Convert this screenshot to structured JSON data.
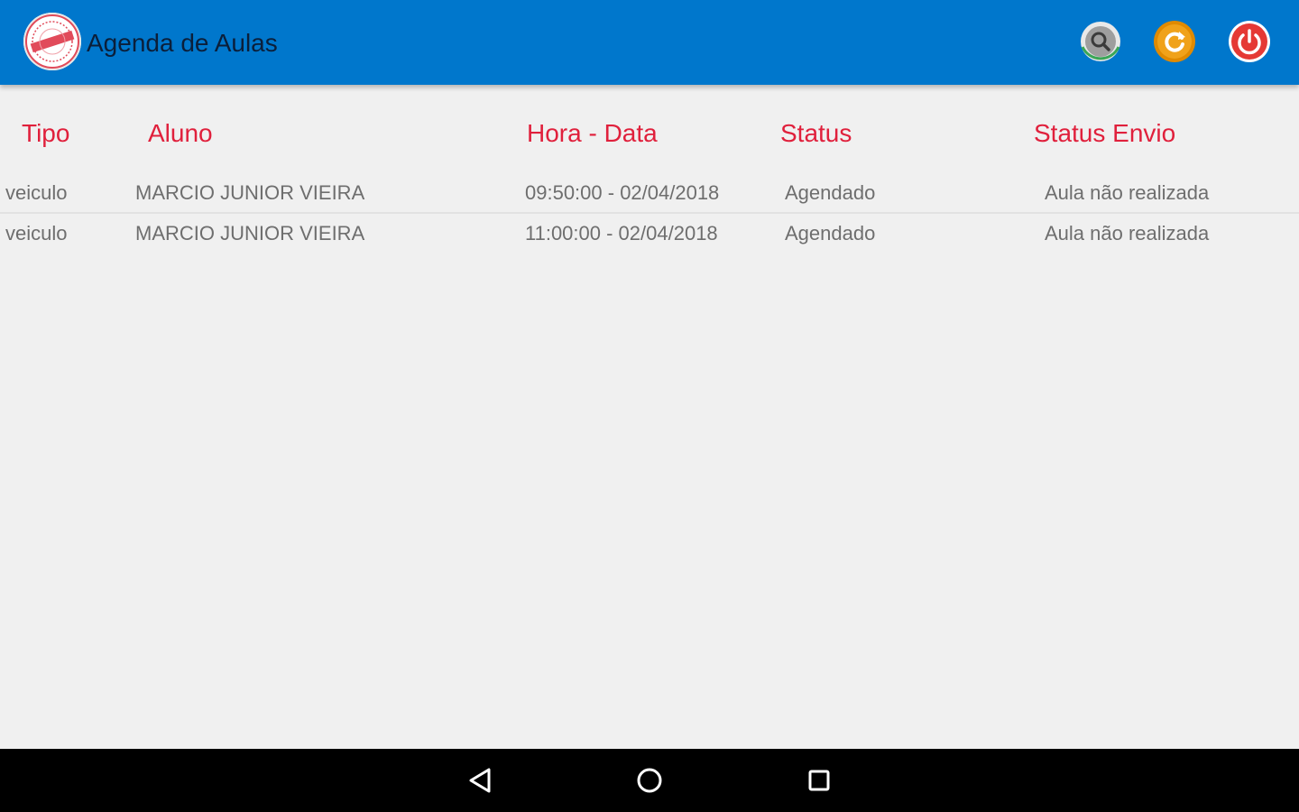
{
  "appbar": {
    "title": "Agenda de Aulas",
    "colors": {
      "background": "#0077cc",
      "title": "#0b1f3a"
    },
    "actions": [
      {
        "name": "search-icon",
        "color": "#9e9e9e"
      },
      {
        "name": "refresh-icon",
        "color": "#e08a00"
      },
      {
        "name": "power-icon",
        "color": "#e53935"
      }
    ]
  },
  "table": {
    "header_color": "#e0203c",
    "headers": {
      "tipo": "Tipo",
      "aluno": "Aluno",
      "hora_data": "Hora - Data",
      "status": "Status",
      "status_envio": "Status Envio"
    },
    "rows": [
      {
        "tipo": "veiculo",
        "aluno": "MARCIO JUNIOR VIEIRA",
        "hora_data": "09:50:00 - 02/04/2018",
        "status": "Agendado",
        "status_envio": "Aula não realizada"
      },
      {
        "tipo": "veiculo",
        "aluno": "MARCIO JUNIOR VIEIRA",
        "hora_data": "11:00:00 - 02/04/2018",
        "status": "Agendado",
        "status_envio": "Aula não realizada"
      }
    ]
  },
  "navbar": {
    "icons": [
      "back-triangle-icon",
      "home-circle-icon",
      "recent-apps-square-icon"
    ]
  }
}
